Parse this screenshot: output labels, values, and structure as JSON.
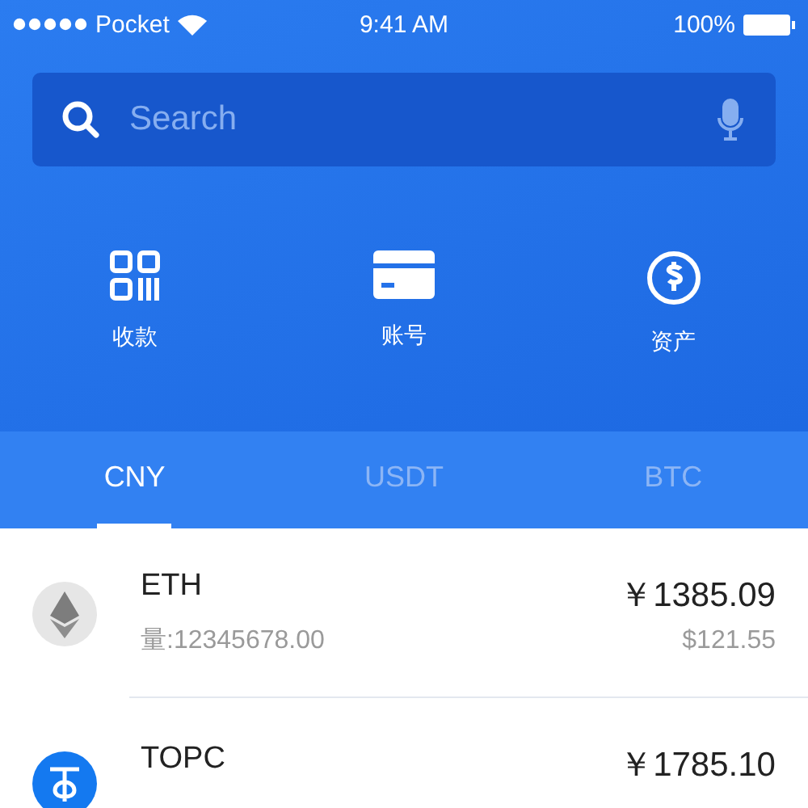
{
  "status_bar": {
    "carrier": "Pocket",
    "time": "9:41 AM",
    "battery": "100%"
  },
  "search": {
    "placeholder": "Search"
  },
  "actions": [
    {
      "kind": "qr",
      "label": "收款"
    },
    {
      "kind": "card",
      "label": "账号"
    },
    {
      "kind": "dollar",
      "label": "资产"
    }
  ],
  "tabs": [
    {
      "label": "CNY",
      "selected": true
    },
    {
      "label": "USDT",
      "selected": false
    },
    {
      "label": "BTC",
      "selected": false
    }
  ],
  "assets": [
    {
      "kind": "eth",
      "name": "ETH",
      "amount": "量:12345678.00",
      "cny": "￥1385.09",
      "usd": "$121.55"
    },
    {
      "kind": "topc",
      "name": "TOPC",
      "cny": "￥1785.10"
    }
  ]
}
